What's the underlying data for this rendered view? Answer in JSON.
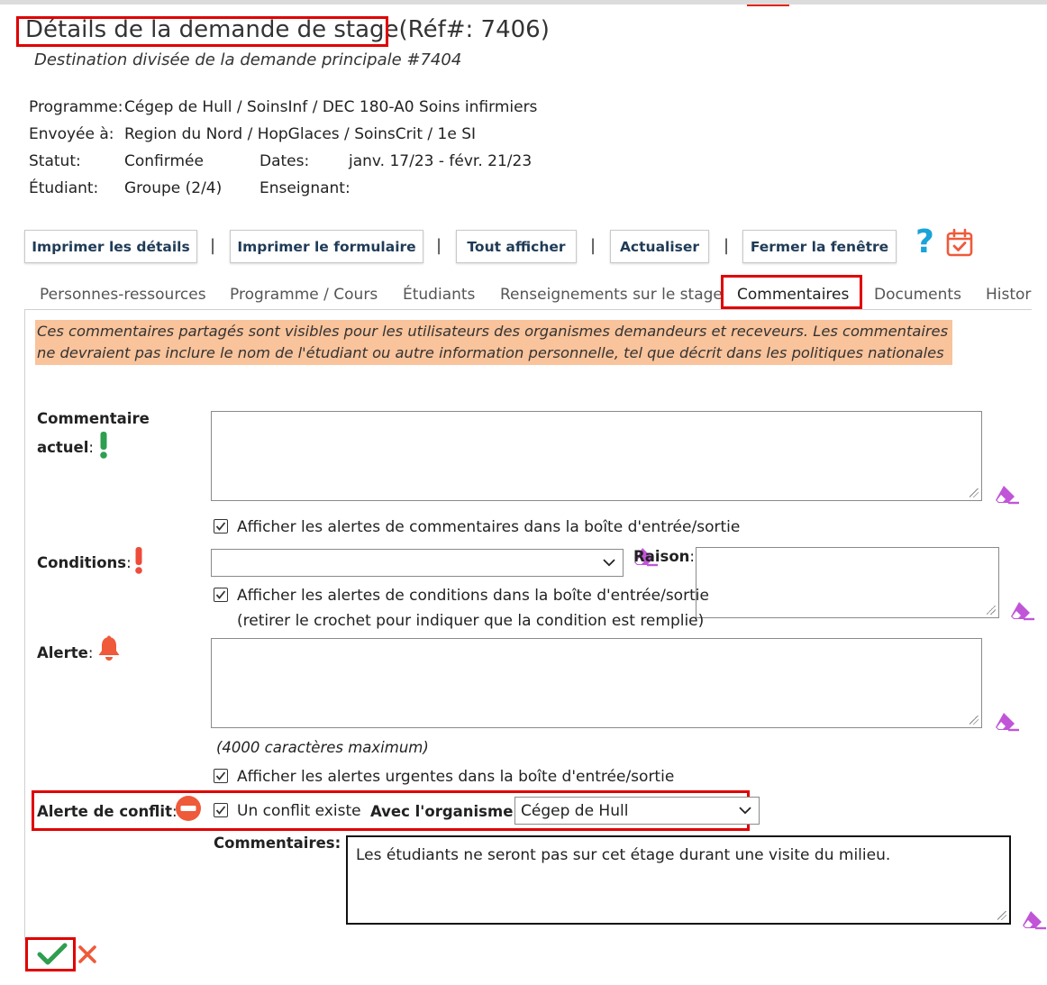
{
  "header": {
    "title": "Détails de la demande de stage",
    "ref": "(Réf#: 7406)",
    "subtitle": "Destination divisée de la demande principale #7404"
  },
  "info": {
    "programme_label": "Programme:",
    "programme_value": "Cégep de Hull / SoinsInf / DEC 180-A0 Soins infirmiers",
    "sent_label": "Envoyée à:",
    "sent_value": "Region du Nord / HopGlaces / SoinsCrit / 1e SI",
    "status_label": "Statut:",
    "status_value": "Confirmée",
    "dates_label": "Dates:",
    "dates_value": "janv. 17/23 - févr. 21/23",
    "student_label": "Étudiant:",
    "student_value": "Groupe (2/4)",
    "teacher_label": "Enseignant:"
  },
  "toolbar": {
    "print_details": "Imprimer les détails",
    "print_form": "Imprimer le formulaire",
    "show_all": "Tout afficher",
    "refresh": "Actualiser",
    "close_window": "Fermer la fenêtre",
    "separator": "|",
    "help_glyph": "?"
  },
  "tabs": [
    {
      "label": "Personnes-ressources"
    },
    {
      "label": "Programme / Cours"
    },
    {
      "label": "Étudiants"
    },
    {
      "label": "Renseignements sur le stage"
    },
    {
      "label": "Commentaires"
    },
    {
      "label": "Documents"
    },
    {
      "label": "Histor"
    }
  ],
  "notice": "Ces commentaires partagés sont visibles pour les utilisateurs des organismes demandeurs et receveurs. Les commentaires ne devraient pas inclure le nom de l'étudiant ou autre information personnelle, tel que décrit dans les politiques nationales de HSPnet.",
  "form": {
    "current_comment_label_1": "Commentaire",
    "current_comment_label_2": "actuel",
    "colon": ":",
    "comment_alert_checkbox": "Afficher les alertes de commentaires dans la boîte d'entrée/sortie",
    "conditions_label": "Conditions",
    "conditions_select_value": "",
    "reason_label": "Raison",
    "conditions_alert_checkbox": "Afficher les alertes de conditions dans la boîte d'entrée/sortie",
    "conditions_hint": "(retirer le crochet pour indiquer que la condition est remplie)",
    "alert_label": "Alerte",
    "max_chars": "(4000 caractères maximum)",
    "urgent_alert_checkbox": "Afficher les alertes urgentes dans la boîte d'entrée/sortie",
    "conflict_label": "Alerte de conflit",
    "conflict_checkbox": "Un conflit existe",
    "with_org_label": "Avec l'organisme:",
    "org_select_value": "Cégep de Hull",
    "conflict_comments_label": "Commentaires:",
    "conflict_comments_value": "Les étudiants ne seront pas sur cet étage durant une visite du milieu."
  },
  "colors": {
    "accent_red": "#e00000",
    "notice_bg": "#f9c39b",
    "green": "#2e9e4f",
    "orange": "#ee5a3a",
    "help_blue": "#1aa3d9",
    "eraser_purple": "#c055d8"
  },
  "icons": {
    "comment_status": "exclamation-green-icon",
    "conditions_status": "exclamation-red-icon",
    "alert_status": "bell-icon",
    "conflict_status": "no-entry-icon",
    "help": "question-icon",
    "calendar": "calendar-check-icon",
    "clear": "eraser-icon",
    "save": "check-icon",
    "cancel": "close-icon"
  }
}
